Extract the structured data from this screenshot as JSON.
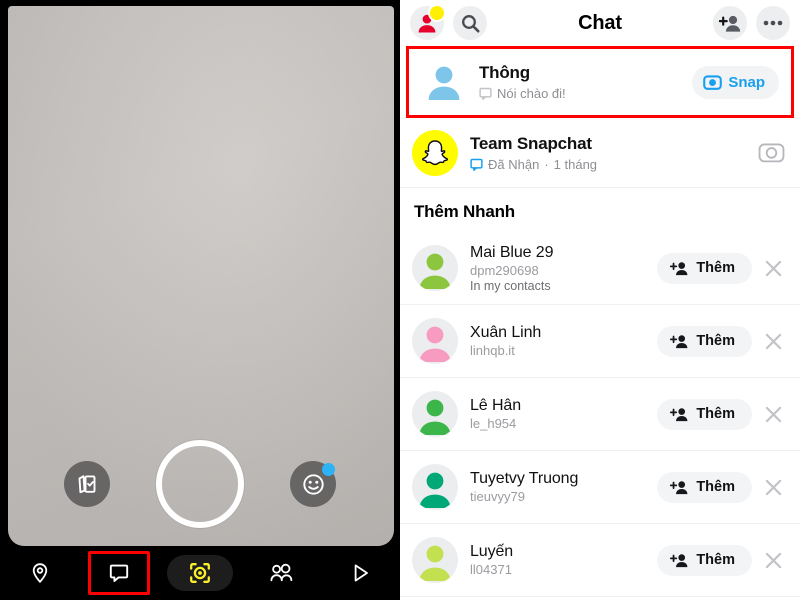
{
  "camera": {
    "controls": {
      "memories_icon": "memories-cards-icon",
      "shutter_label": "shutter-button",
      "lens_icon": "lens-smiley-icon"
    },
    "bottom_nav": [
      {
        "id": "map",
        "icon": "location-pin-icon",
        "highlighted": false
      },
      {
        "id": "chat",
        "icon": "chat-bubble-icon",
        "highlighted": true
      },
      {
        "id": "camera",
        "icon": "scan-camera-icon",
        "highlighted": false
      },
      {
        "id": "friends",
        "icon": "friends-icon",
        "highlighted": false
      },
      {
        "id": "stories",
        "icon": "play-triangle-icon",
        "highlighted": false
      }
    ]
  },
  "chat": {
    "header": {
      "title": "Chat",
      "profile_icon": "bitmoji-avatar-icon",
      "profile_badge_color": "#FFF000",
      "search_icon": "search-icon",
      "add_friend_icon": "add-friend-icon",
      "more_icon": "more-options-icon"
    },
    "conversations": [
      {
        "name": "Thông",
        "status": "Nói chào đi!",
        "status_icon": "chat-bubble-icon",
        "status_icon_color": "#c7c7cc",
        "avatar_color": "#7ec5ea",
        "avatar_bg": "transparent",
        "highlighted": true,
        "action": {
          "type": "snap",
          "label": "Snap",
          "icon": "camera-icon",
          "color": "#18A0F0"
        }
      },
      {
        "name": "Team Snapchat",
        "status": "Đã Nhận",
        "status_meta": "1 tháng",
        "status_separator": "·",
        "status_icon": "chat-bubble-icon",
        "status_icon_color": "#18A0F0",
        "avatar_color": "#ffffff",
        "avatar_bg": "#FFFC00",
        "avatar_icon": "snapchat-ghost-icon",
        "highlighted": false,
        "action": {
          "type": "camera",
          "icon": "camera-outline-icon"
        }
      }
    ],
    "quick_add": {
      "section_title": "Thêm Nhanh",
      "add_label": "Thêm",
      "add_icon": "add-person-icon",
      "dismiss_icon": "close-icon",
      "people": [
        {
          "name": "Mai Blue 29",
          "username": "dpm290698",
          "note": "In my contacts",
          "avatar_color": "#8CC63F"
        },
        {
          "name": "Xuân Linh",
          "username": "linhqb.it",
          "note": "",
          "avatar_color": "#F79BC0"
        },
        {
          "name": "Lê Hân",
          "username": "le_h954",
          "note": "",
          "avatar_color": "#3CB54A"
        },
        {
          "name": "Tuyetvy Truong",
          "username": "tieuvyy79",
          "note": "",
          "avatar_color": "#00A878"
        },
        {
          "name": "Luyến",
          "username": "ll04371",
          "note": "",
          "avatar_color": "#C3E050"
        }
      ]
    }
  },
  "colors": {
    "snapchat_yellow": "#FFFC00",
    "accent_blue": "#18A0F0",
    "highlight_red": "#FF0000",
    "panel_white": "#FFFFFF",
    "nav_black": "#000000"
  }
}
